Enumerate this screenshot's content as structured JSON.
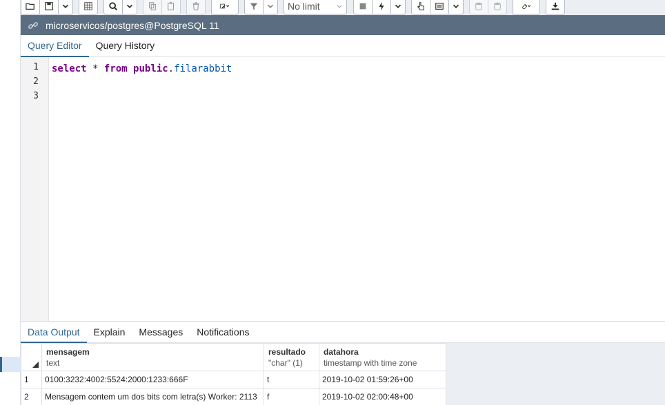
{
  "toolbar": {
    "limit_select": {
      "value": "No limit"
    }
  },
  "connection": {
    "name": "microservicos/postgres@PostgreSQL 11"
  },
  "editor_tabs": [
    {
      "label": "Query Editor",
      "active": true
    },
    {
      "label": "Query History",
      "active": false
    }
  ],
  "editor": {
    "line_numbers": [
      "1",
      "2",
      "3"
    ],
    "tokens": {
      "kw1": "select",
      "star": "*",
      "kw2": "from",
      "schema": "public",
      "dot": ".",
      "table": "filarabbit"
    }
  },
  "output_tabs": [
    {
      "label": "Data Output",
      "active": true
    },
    {
      "label": "Explain",
      "active": false
    },
    {
      "label": "Messages",
      "active": false
    },
    {
      "label": "Notifications",
      "active": false
    }
  ],
  "grid": {
    "columns": [
      {
        "name": "mensagem",
        "type": "text"
      },
      {
        "name": "resultado",
        "type": "\"char\" (1)"
      },
      {
        "name": "datahora",
        "type": "timestamp with time zone"
      }
    ],
    "rows": [
      {
        "num": "1",
        "mensagem": "0100:3232:4002:5524:2000:1233:666F",
        "resultado": "t",
        "datahora": "2019-10-02 01:59:26+00"
      },
      {
        "num": "2",
        "mensagem": "Mensagem contem um dos bits com letra(s) Worker: 2113",
        "resultado": "f",
        "datahora": "2019-10-02 02:00:48+00"
      }
    ]
  },
  "colors": {
    "accent": "#326690",
    "connection_bar": "#5b6d80",
    "keyword": "#770088",
    "identifier": "#0055aa"
  }
}
